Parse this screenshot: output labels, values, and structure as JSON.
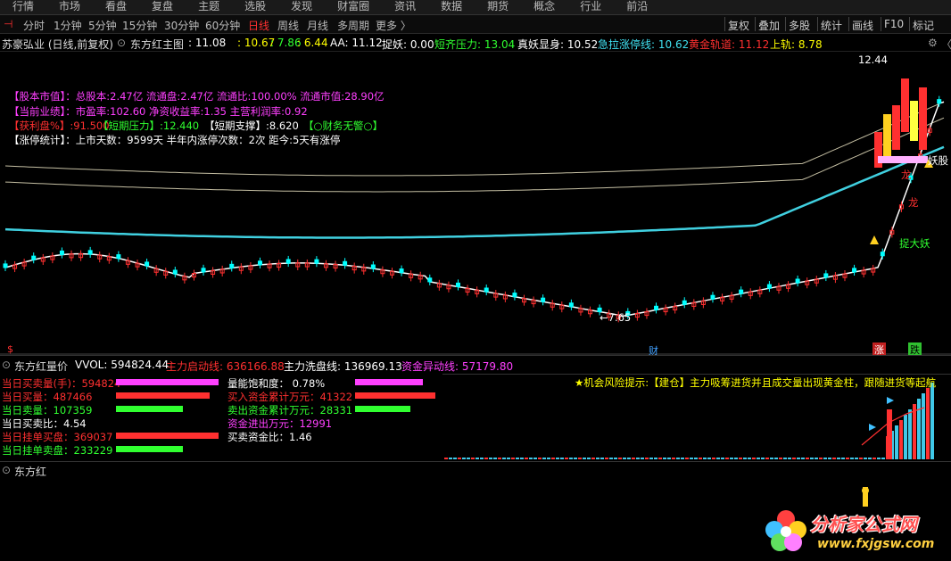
{
  "menu": [
    "行情",
    "市场",
    "看盘",
    "复盘",
    "主题",
    "选股",
    "发现",
    "财富圈",
    "资讯",
    "数据",
    "期货",
    "概念",
    "行业",
    "前沿"
  ],
  "period_tabs": [
    {
      "label": "分时",
      "active": false
    },
    {
      "label": "1分钟",
      "active": false
    },
    {
      "label": "5分钟",
      "active": false
    },
    {
      "label": "15分钟",
      "active": false
    },
    {
      "label": "30分钟",
      "active": false
    },
    {
      "label": "60分钟",
      "active": false
    },
    {
      "label": "日线",
      "active": true
    },
    {
      "label": "周线",
      "active": false
    },
    {
      "label": "月线",
      "active": false
    },
    {
      "label": "多周期",
      "active": false
    },
    {
      "label": "更多 〉",
      "active": false
    }
  ],
  "right_tools": [
    "复权",
    "叠加",
    "多股",
    "统计",
    "画线",
    "F10",
    "标记"
  ],
  "info": {
    "stock": "苏豪弘业 (日线,前复权)",
    "indicator": "东方红主图",
    "v1": ": 11.08",
    "v2": ": 10.67",
    "v3": ": 7.86",
    "v4": ": 6.44",
    "aa": "AA: 11.12",
    "zhuoyao": "捉妖: 0.00",
    "duanqi": "短齐压力: 13.04",
    "zhenyao": "真妖显身: 10.52",
    "jila": "急拉涨停线: 10.62",
    "huangjin": "黄金轨道: 11.12",
    "shanggui": "上轨: 8.78"
  },
  "fin": {
    "row1": "【股本市值】：总股本:2.47亿  流通盘:2.47亿  流通比:100.00%  流通市值:28.90亿",
    "row2": "【当前业绩】：市盈率:102.60  净资收益率:1.35  主营利润率:0.92",
    "row3a": "【获利盘%】:91.500",
    "row3b": "【短期压力】:12.440",
    "row3c": "【短期支撑】:8.620",
    "row3d": "【○财务无警○】",
    "row4": "【涨停统计】：上市天数：9599天  半年内涨停次数：2次   距今:5天有涨停"
  },
  "annotations": {
    "high": "12.44",
    "low": "←7.65",
    "yaogu": "妖股",
    "long1": "龙",
    "long2": "龙",
    "zhuodayao": "捉大妖",
    "mark_dollar": "$",
    "mark_cai": "财",
    "mark_zhang": "涨",
    "mark_die": "跌"
  },
  "vol_header": {
    "title": "东方红量价",
    "vvol": "VVOL: 594824.44",
    "zhuli": "主力启动线: 636166.88",
    "xipan": "主力洗盘线: 136969.13",
    "zijin": "资金异动线: 57179.80"
  },
  "vol_left": [
    {
      "label": "当日买卖量(手)：594824",
      "color": "#ff3030"
    },
    {
      "label": "当日买量：487466",
      "color": "#ff3030"
    },
    {
      "label": "当日卖量：107359",
      "color": "#30ff30"
    },
    {
      "label": "当日买卖比：4.54",
      "color": "#ffffff"
    },
    {
      "label": "当日挂单买盘：369037",
      "color": "#ff3030"
    },
    {
      "label": "当日挂单卖盘：233229",
      "color": "#30ff30"
    }
  ],
  "vol_mid": [
    {
      "label": "量能饱和度： 0.78%",
      "color": "#ffffff"
    },
    {
      "label": "买入资金累计万元：41322",
      "color": "#ff3030"
    },
    {
      "label": "卖出资金累计万元：28331",
      "color": "#30ff30"
    },
    {
      "label": "资金进出万元：12991",
      "color": "#ff40ff"
    },
    {
      "label": "买卖资金比：1.46",
      "color": "#ffffff"
    }
  ],
  "risk_tip": "★机会风险提示:【建仓】主力吸筹进货并且成交量出现黄金柱，跟随进货等起航",
  "df_title": "东方红",
  "watermark": {
    "cn": "分析家公式网",
    "url": "www.fxjgsw.com"
  },
  "colors": {
    "up": "#ff3030",
    "down": "#00ffff",
    "ma_cyan": "#40d0e0",
    "envelope": "#e8e0c0",
    "magenta": "#ff40ff",
    "yellow": "#ffff00",
    "green": "#30ff30"
  }
}
